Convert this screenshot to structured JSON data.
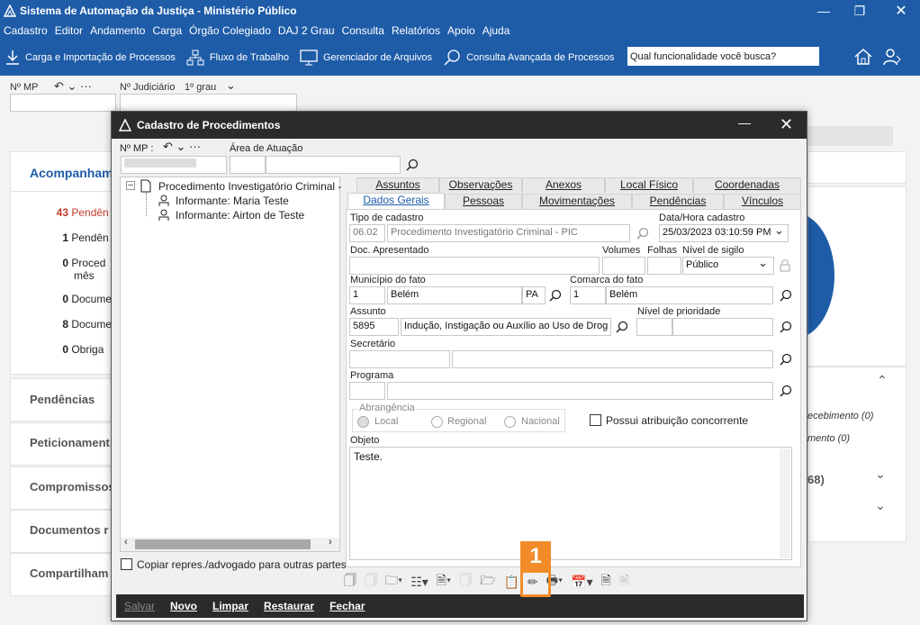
{
  "app_title": "Sistema de Automação da Justiça - Ministério Público",
  "menu": [
    "Cadastro",
    "Editor",
    "Andamento",
    "Carga",
    "Órgão Colegiado",
    "DAJ 2 Grau",
    "Consulta",
    "Relatórios",
    "Apoio",
    "Ajuda"
  ],
  "toolbar": {
    "carga": "Carga e Importação de Processos",
    "fluxo": "Fluxo de Trabalho",
    "gerenciador": "Gerenciador de Arquivos",
    "consulta": "Consulta Avançada de Processos",
    "search_value": "Qual funcionalidade você busca?"
  },
  "bg": {
    "nmp_label": "Nº MP",
    "njud_label": "Nº Judiciário",
    "grau": "1º grau",
    "acomp_title": "Acompanhame",
    "stats": [
      {
        "n": "43",
        "t": "Pendên",
        "red": true
      },
      {
        "n": "1",
        "t": "Pendên"
      },
      {
        "n": "0",
        "t": "Proced",
        "t2": "mês"
      },
      {
        "n": "0",
        "t": "Docume"
      },
      {
        "n": "8",
        "t": "Docume"
      },
      {
        "n": "0",
        "t": "Obriga"
      }
    ],
    "sections": [
      "Pendências",
      "Peticionament",
      "Compromissos",
      "Documentos r",
      "Compartilham"
    ],
    "right_items": [
      "ecebimento (0)",
      "mento (0)",
      "68)"
    ]
  },
  "dialog": {
    "title": "Cadastro de Procedimentos",
    "nmp_label": "Nº MP :",
    "area_label": "Área de Atuação",
    "tree": {
      "root": "Procedimento Investigatório Criminal -",
      "children": [
        "Informante: Maria Teste",
        "Informante: Airton de Teste"
      ]
    },
    "copy_label": "Copiar repres./advogado para outras partes",
    "tabs_top": [
      "Assuntos",
      "Observações",
      "Anexos",
      "Local Físico",
      "Coordenadas"
    ],
    "tabs_bottom": [
      "Dados Gerais",
      "Pessoas",
      "Movimentações",
      "Pendências",
      "Vínculos"
    ],
    "labels": {
      "tipo": "Tipo de cadastro",
      "datahora": "Data/Hora cadastro",
      "doc": "Doc. Apresentado",
      "volumes": "Volumes",
      "folhas": "Folhas",
      "sigilo": "Nível de sigilo",
      "municipio": "Município do fato",
      "comarca": "Comarca do fato",
      "assunto": "Assunto",
      "prioridade": "Nível de prioridade",
      "secretario": "Secretário",
      "programa": "Programa",
      "abrangencia": "Abrangência",
      "objeto": "Objeto"
    },
    "values": {
      "tipo_code": "06.02",
      "tipo_desc": "Procedimento Investigatório Criminal - PIC",
      "datahora": "25/03/2023 03:10:59 PM",
      "sigilo": "Público",
      "mun_code": "1",
      "mun_name": "Belém",
      "mun_uf": "PA",
      "com_code": "1",
      "com_name": "Belém",
      "assunto_code": "5895",
      "assunto_desc": "Indução, Instigação ou Auxílio ao Uso de Drog",
      "objeto": "Teste."
    },
    "abrang_options": [
      "Local",
      "Regional",
      "Nacional"
    ],
    "concorrente": "Possui atribuição concorrente",
    "actions": [
      "Salvar",
      "Novo",
      "Limpar",
      "Restaurar",
      "Fechar"
    ],
    "badge": "1"
  }
}
